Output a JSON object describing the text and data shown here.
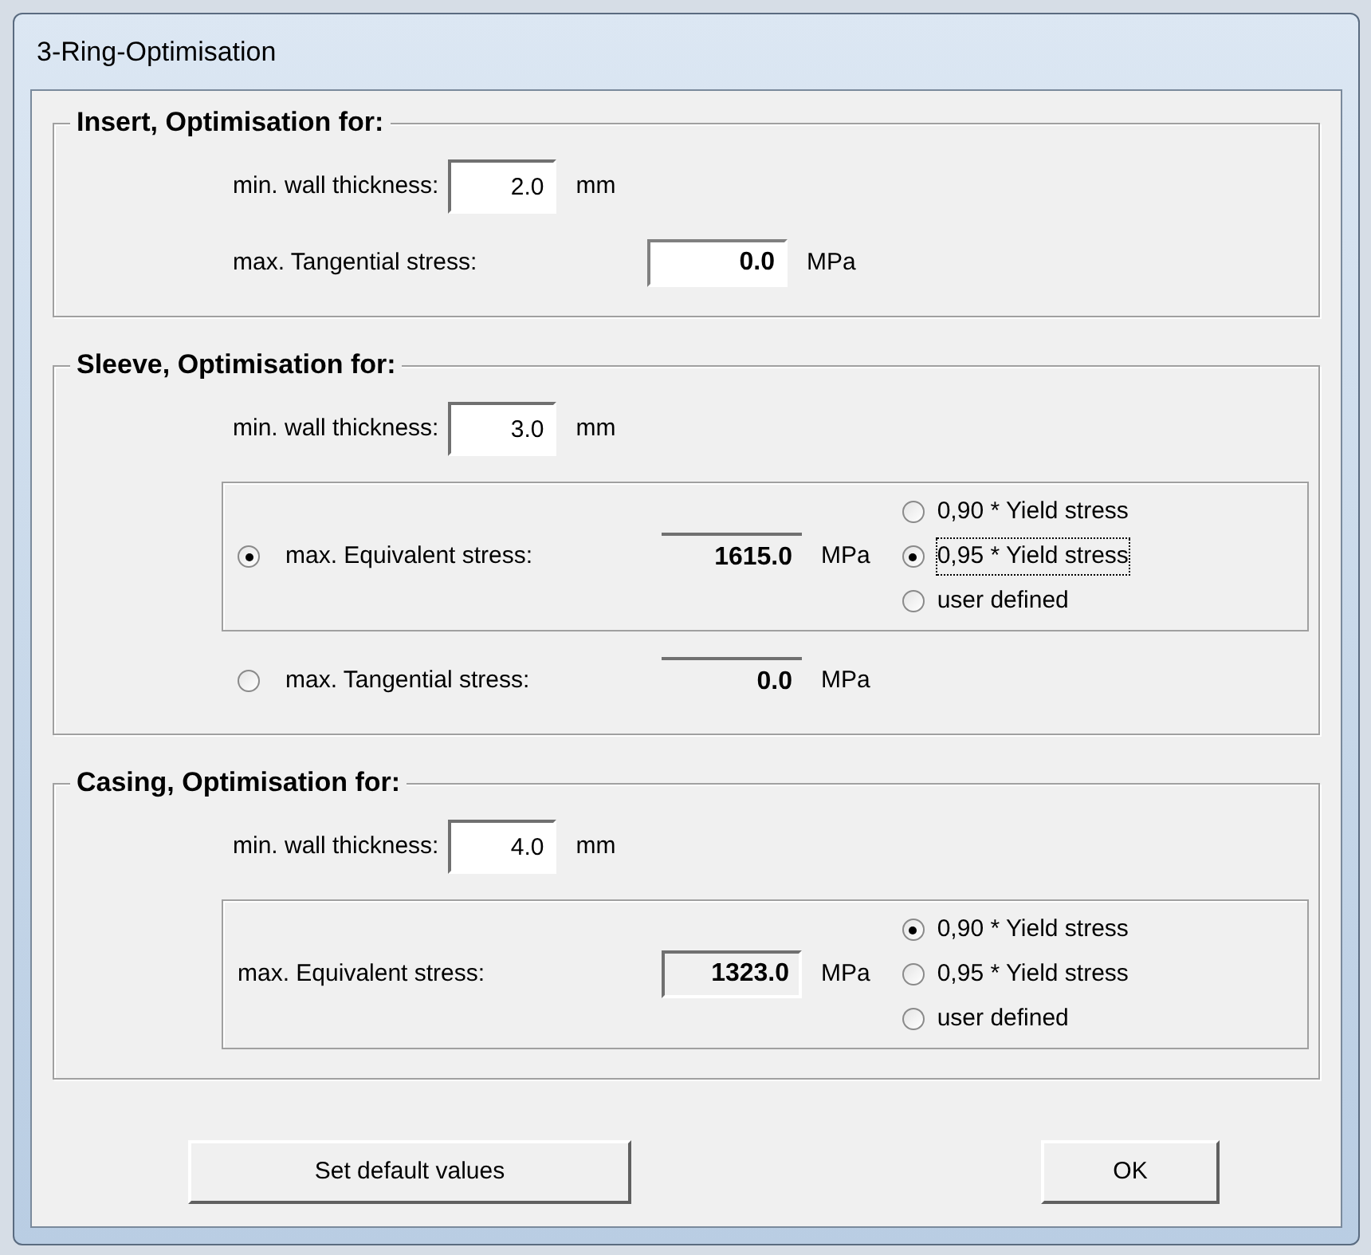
{
  "window": {
    "title": "3-Ring-Optimisation"
  },
  "sections": [
    {
      "title": "Insert, Optimisation for:",
      "rows": [
        {
          "kind": "input",
          "label": "min. wall thickness:",
          "value": "2.0",
          "unit": "mm"
        },
        {
          "kind": "output",
          "label": "max. Tangential stress:",
          "display": {
            "kind": "white",
            "text": "0.0"
          },
          "unit": "MPa"
        }
      ]
    },
    {
      "title": "Sleeve, Optimisation for:",
      "rows": [
        {
          "kind": "input",
          "label": "min. wall thickness:",
          "value": "3.0",
          "unit": "mm"
        },
        {
          "kind": "choice_group",
          "selected": true,
          "label": "max. Equivalent stress:",
          "display": {
            "kind": "flat",
            "text": "1615.0"
          },
          "unit": "MPa",
          "options": [
            {
              "label": "0,90 * Yield stress",
              "selected": false,
              "focused": false
            },
            {
              "label": "0,95 * Yield stress",
              "selected": true,
              "focused": true
            },
            {
              "label": "user defined",
              "selected": false,
              "focused": false
            }
          ]
        },
        {
          "kind": "output",
          "selected": false,
          "label": "max. Tangential stress:",
          "display": {
            "kind": "flat",
            "text": "0.0"
          },
          "unit": "MPa"
        }
      ]
    },
    {
      "title": "Casing, Optimisation for:",
      "rows": [
        {
          "kind": "input",
          "label": "min. wall thickness:",
          "value": "4.0",
          "unit": "mm"
        },
        {
          "kind": "choice_group",
          "label": "max. Equivalent stress:",
          "display": {
            "kind": "sunken",
            "text": "1323.0"
          },
          "unit": "MPa",
          "options": [
            {
              "label": "0,90 * Yield stress",
              "selected": true,
              "focused": false
            },
            {
              "label": "0,95 * Yield stress",
              "selected": false,
              "focused": false
            },
            {
              "label": "user defined",
              "selected": false,
              "focused": false
            }
          ]
        }
      ]
    }
  ],
  "buttons": [
    {
      "label": "Set default values"
    },
    {
      "label": "OK"
    }
  ]
}
